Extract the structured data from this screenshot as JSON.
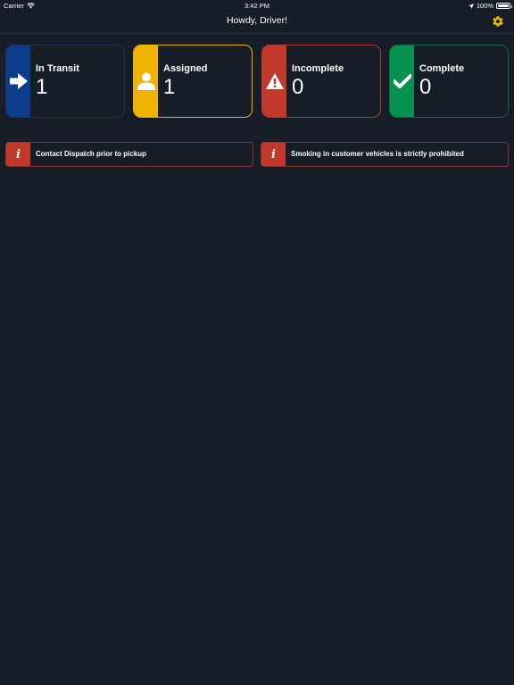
{
  "status_bar": {
    "carrier": "Carrier",
    "time": "3:42 PM",
    "battery": "100%",
    "battery_level": 1.0
  },
  "nav": {
    "title": "Howdy, Driver!",
    "settings_icon": "gear-icon",
    "accent_color": "#f0b400"
  },
  "cards": [
    {
      "label": "In Transit",
      "count": "1",
      "icon": "arrow-right-icon",
      "color": "#0b3d8c",
      "border": "#1d3552"
    },
    {
      "label": "Assigned",
      "count": "1",
      "icon": "person-icon",
      "color": "#f0b400",
      "border": "#f0b400"
    },
    {
      "label": "Incomplete",
      "count": "0",
      "icon": "warning-icon",
      "color": "#c0392b",
      "border": "#b23a2f"
    },
    {
      "label": "Complete",
      "count": "0",
      "icon": "checkmark-icon",
      "color": "#079150",
      "border": "#0a6b3f"
    }
  ],
  "notices": [
    {
      "icon_text": "i",
      "text": "Contact Dispatch prior to pickup",
      "color": "#c0392b",
      "border": "#8a3530"
    },
    {
      "icon_text": "i",
      "text": "Smoking in customer vehicles is strictly prohibited",
      "color": "#c0392b",
      "border": "#8a3530"
    }
  ]
}
